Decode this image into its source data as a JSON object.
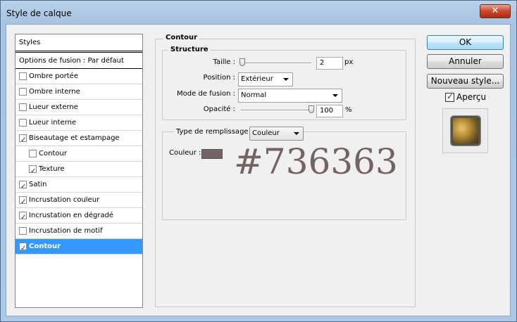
{
  "window": {
    "title": "Style de calque",
    "close_glyph": "✕"
  },
  "styles_panel": {
    "header": "Styles",
    "fusion_label": "Options de fusion : Par défaut",
    "items": [
      {
        "label": "Ombre portée",
        "checked": false,
        "indent": 0,
        "selected": false
      },
      {
        "label": "Ombre interne",
        "checked": false,
        "indent": 0,
        "selected": false
      },
      {
        "label": "Lueur externe",
        "checked": false,
        "indent": 0,
        "selected": false
      },
      {
        "label": "Lueur interne",
        "checked": false,
        "indent": 0,
        "selected": false
      },
      {
        "label": "Biseautage et estampage",
        "checked": true,
        "indent": 0,
        "selected": false
      },
      {
        "label": "Contour",
        "checked": false,
        "indent": 1,
        "selected": false
      },
      {
        "label": "Texture",
        "checked": true,
        "indent": 1,
        "selected": false
      },
      {
        "label": "Satin",
        "checked": true,
        "indent": 0,
        "selected": false
      },
      {
        "label": "Incrustation couleur",
        "checked": true,
        "indent": 0,
        "selected": false
      },
      {
        "label": "Incrustation en dégradé",
        "checked": true,
        "indent": 0,
        "selected": false
      },
      {
        "label": "Incrustation de motif",
        "checked": false,
        "indent": 0,
        "selected": false
      },
      {
        "label": "Contour",
        "checked": true,
        "indent": 0,
        "selected": true
      }
    ]
  },
  "contour": {
    "group_title": "Contour",
    "structure": {
      "title": "Structure",
      "taille_label": "Taille :",
      "taille_value": "2",
      "taille_unit": "px",
      "taille_level": 0.02,
      "position_label": "Position :",
      "position_value": "Extérieur",
      "mode_label": "Mode de fusion :",
      "mode_value": "Normal",
      "opacite_label": "Opacité :",
      "opacite_value": "100",
      "opacite_unit": "%",
      "opacite_level": 1.0
    },
    "fill": {
      "type_label": "Type de remplissage :",
      "type_value": "Couleur",
      "couleur_label": "Couleur :",
      "couleur_hex": "#736363",
      "annotation": "#736363"
    }
  },
  "buttons": {
    "ok": "OK",
    "annuler": "Annuler",
    "nouveau_style": "Nouveau style...",
    "apercu_label": "Aperçu",
    "apercu_checked": true
  },
  "colors": {
    "selection": "#3399ff",
    "stroke_color": "#736363"
  }
}
